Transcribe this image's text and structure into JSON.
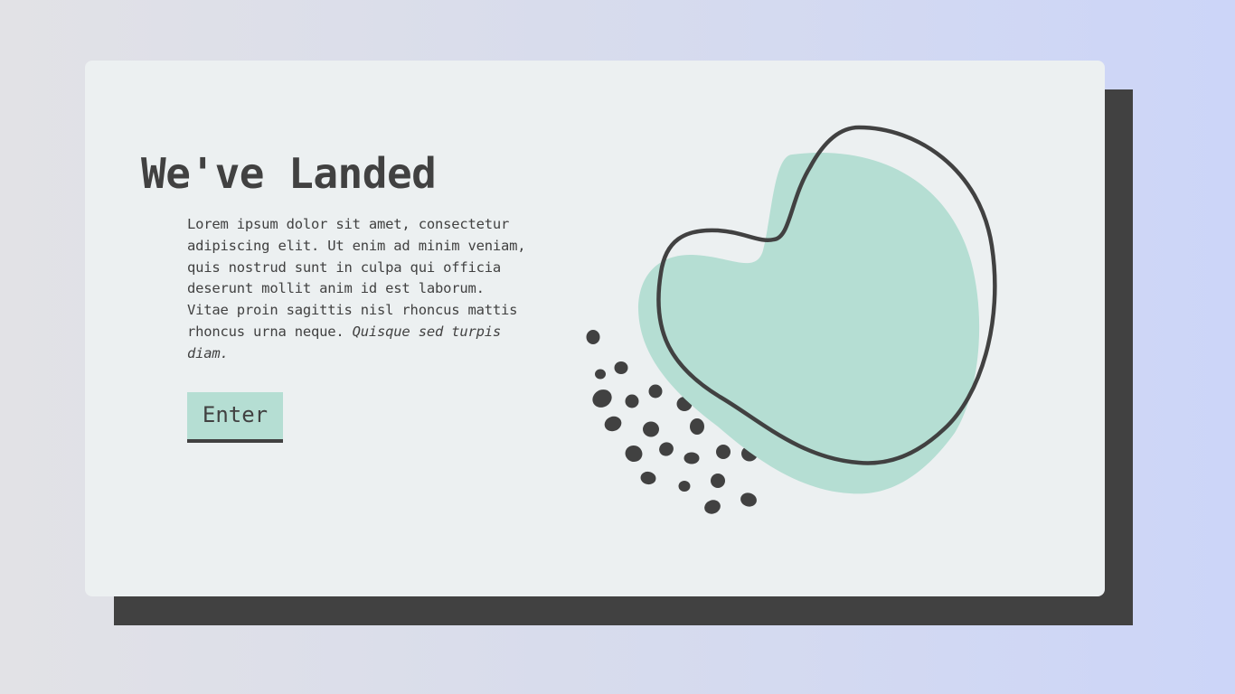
{
  "hero": {
    "title": "We've Landed",
    "description_lines": [
      "Lorem ipsum dolor sit amet, consectetur",
      "adipiscing elit. Ut enim ad minim veniam,",
      "quis nostrud sunt in culpa qui officia",
      "deserunt mollit anim id est laborum.",
      "Vitae proin sagittis nisl rhoncus mattis",
      "rhoncus urna neque. "
    ],
    "description_emphasis": "Quisque sed turpis diam.",
    "cta_label": "Enter"
  },
  "colors": {
    "page_background_start": "#e2e2e6",
    "page_background_end": "#ccd5f8",
    "card_background": "#ecf0f1",
    "shadow_block": "#414141",
    "accent_mint": "#b5ded3",
    "text_dark": "#414141"
  }
}
